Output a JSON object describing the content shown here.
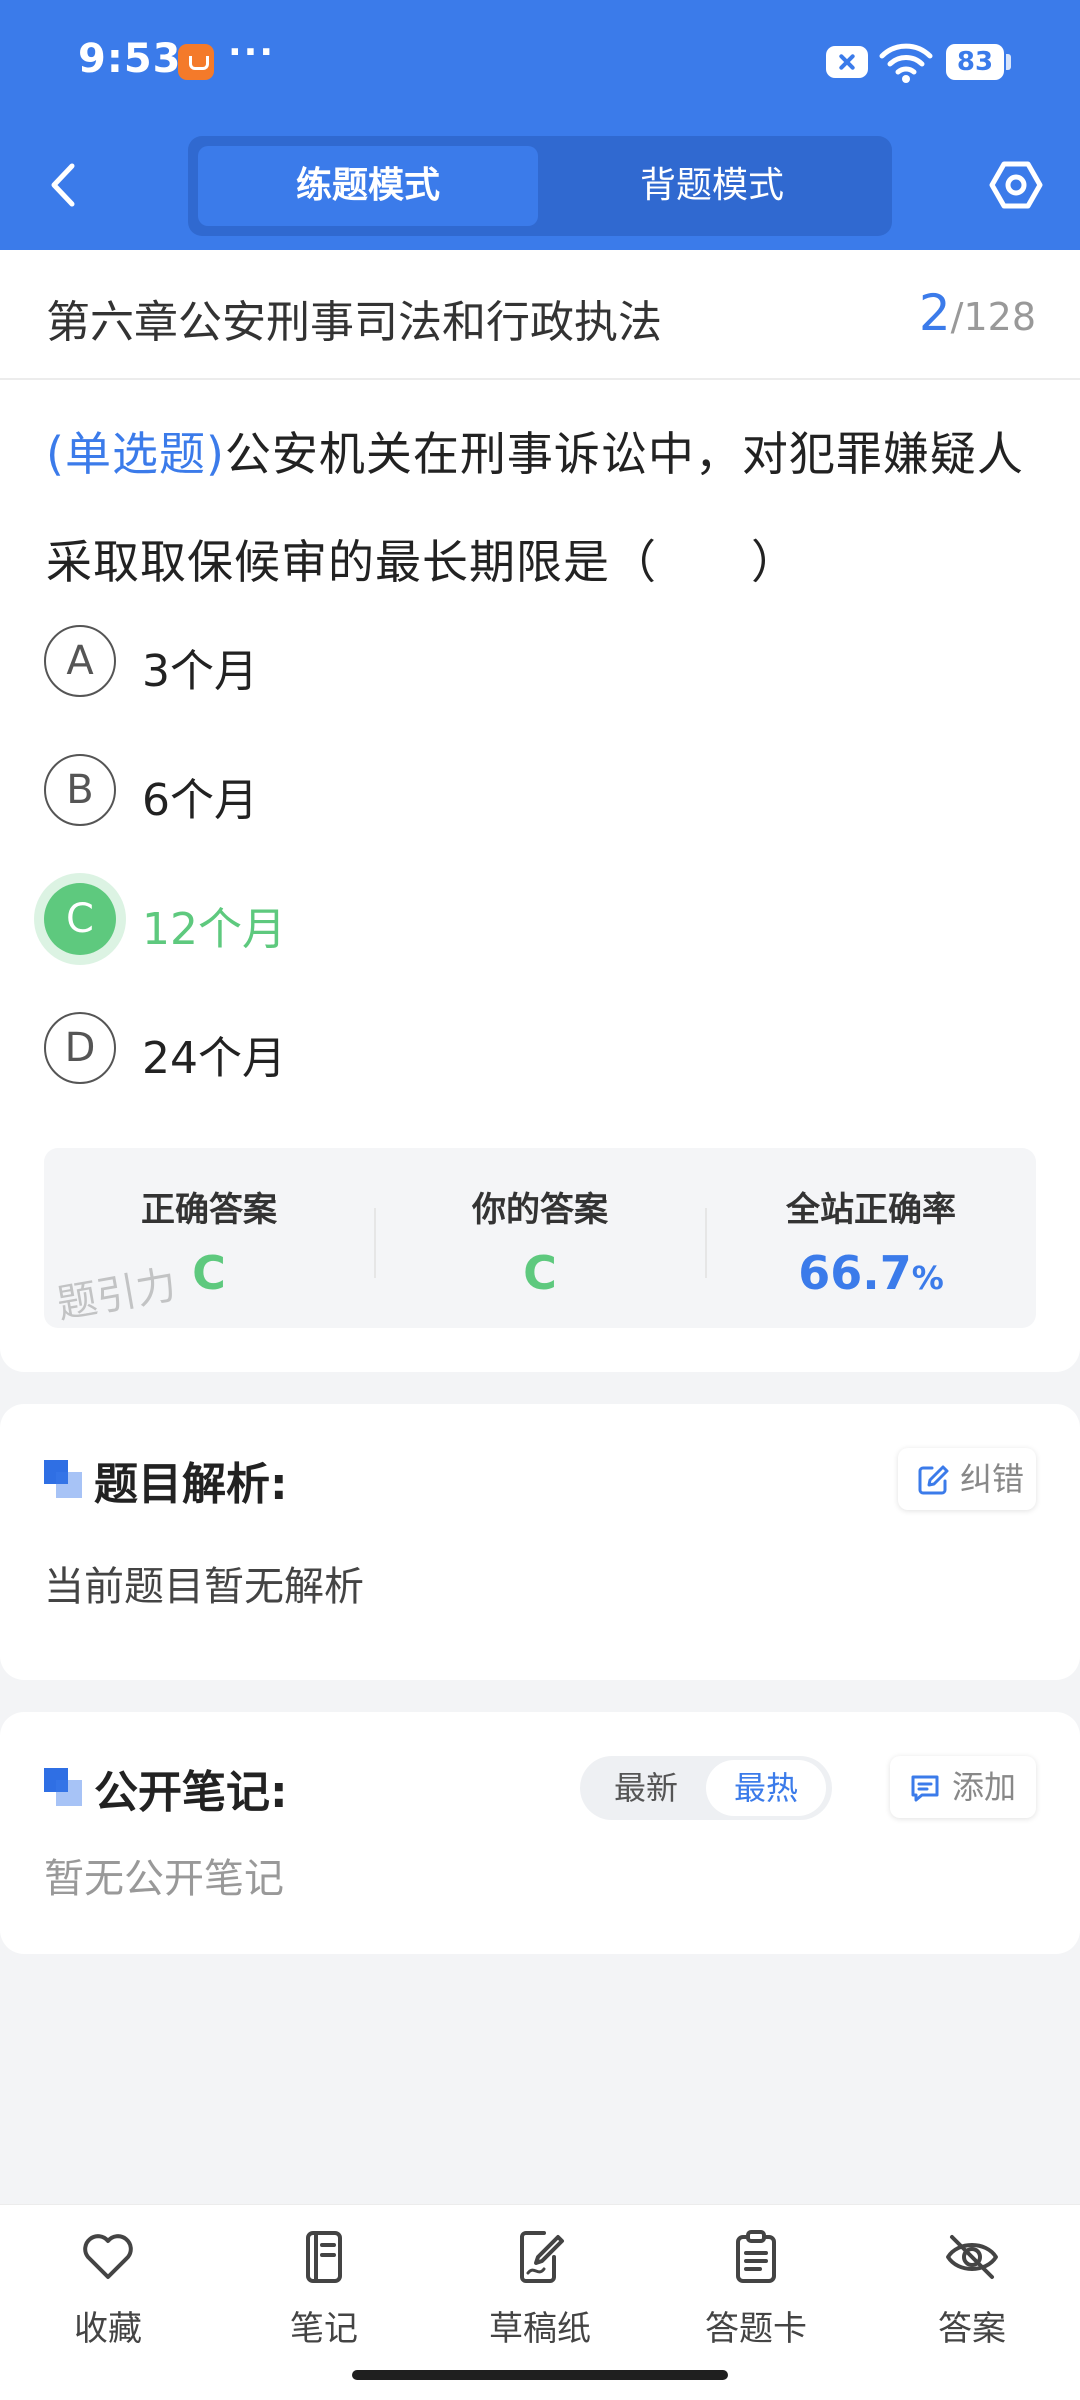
{
  "status_bar": {
    "time": "9:53",
    "more": "···",
    "battery": "83"
  },
  "header": {
    "tabs": [
      {
        "label": "练题模式",
        "active": true
      },
      {
        "label": "背题模式",
        "active": false
      }
    ],
    "icons": {
      "back": "back-arrow-icon",
      "settings": "settings-hexagon-icon"
    }
  },
  "chapter": {
    "title": "第六章公安刑事司法和行政执法",
    "current": "2",
    "total": "/128"
  },
  "question": {
    "type": "(单选题)",
    "text": "公安机关在刑事诉讼中，对犯罪嫌疑人采取取保候审的最长期限是（　　）"
  },
  "options": [
    {
      "letter": "A",
      "text": "3个月"
    },
    {
      "letter": "B",
      "text": "6个月"
    },
    {
      "letter": "C",
      "text": "12个月"
    },
    {
      "letter": "D",
      "text": "24个月"
    }
  ],
  "answer": {
    "correct_label": "正确答案",
    "correct_value": "C",
    "yours_label": "你的答案",
    "yours_value": "C",
    "rate_label": "全站正确率",
    "rate_value": "66.7",
    "rate_unit": "%",
    "watermark": "题引力"
  },
  "analysis": {
    "title": "题目解析:",
    "report_button": "纠错",
    "text": "当前题目暂无解析"
  },
  "notes": {
    "title": "公开笔记:",
    "sort_latest": "最新",
    "sort_hot": "最热",
    "add_button": "添加",
    "empty_text": "暂无公开笔记"
  },
  "bottom_bar": [
    {
      "label": "收藏",
      "icon": "heart-icon"
    },
    {
      "label": "笔记",
      "icon": "notebook-icon"
    },
    {
      "label": "草稿纸",
      "icon": "draft-paper-icon"
    },
    {
      "label": "答题卡",
      "icon": "answer-card-icon"
    },
    {
      "label": "答案",
      "icon": "eye-off-icon"
    }
  ],
  "colors": {
    "primary": "#3b7bea",
    "correct": "#5ec97e",
    "background": "#f3f4f6"
  }
}
